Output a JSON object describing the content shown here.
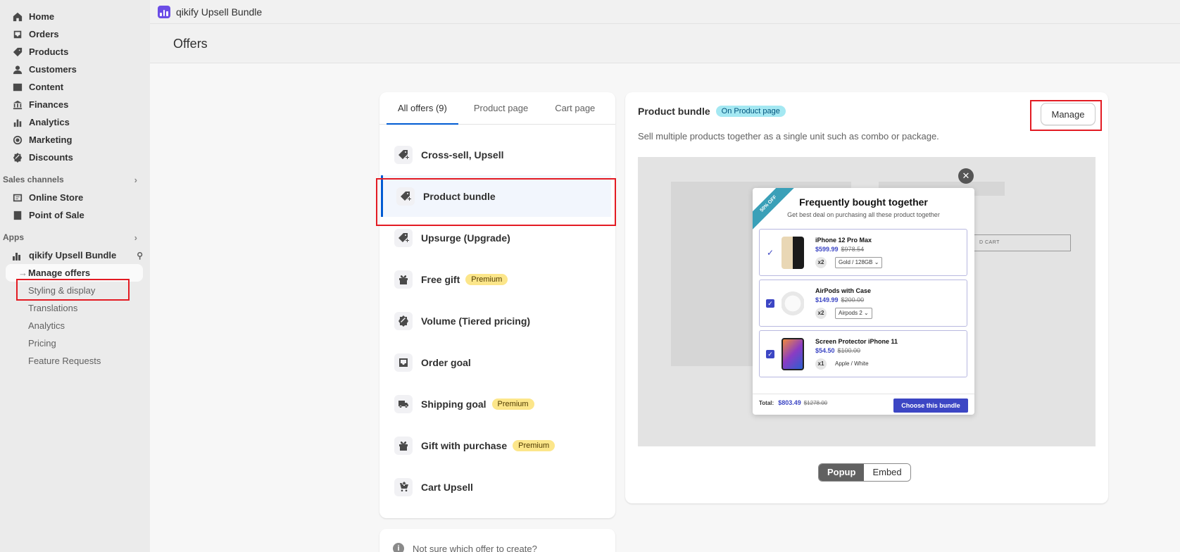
{
  "sidebar": {
    "nav": [
      {
        "label": "Home",
        "icon": "home-icon"
      },
      {
        "label": "Orders",
        "icon": "orders-icon"
      },
      {
        "label": "Products",
        "icon": "tag-icon"
      },
      {
        "label": "Customers",
        "icon": "person-icon"
      },
      {
        "label": "Content",
        "icon": "content-icon"
      },
      {
        "label": "Finances",
        "icon": "bank-icon"
      },
      {
        "label": "Analytics",
        "icon": "bar-chart-icon"
      },
      {
        "label": "Marketing",
        "icon": "target-icon"
      },
      {
        "label": "Discounts",
        "icon": "discount-icon"
      }
    ],
    "sales_channels_heading": "Sales channels",
    "channels": [
      {
        "label": "Online Store",
        "icon": "store-icon"
      },
      {
        "label": "Point of Sale",
        "icon": "pos-icon"
      }
    ],
    "apps_heading": "Apps",
    "app_name": "qikify Upsell Bundle",
    "app_subitems": [
      "Manage offers",
      "Styling & display",
      "Translations",
      "Analytics",
      "Pricing",
      "Feature Requests"
    ]
  },
  "topbar": {
    "title": "qikify Upsell Bundle"
  },
  "page": {
    "title": "Offers"
  },
  "offers": {
    "tabs": [
      "All offers (9)",
      "Product page",
      "Cart page"
    ],
    "items": [
      {
        "label": "Cross-sell, Upsell",
        "premium": ""
      },
      {
        "label": "Product bundle",
        "premium": ""
      },
      {
        "label": "Upsurge (Upgrade)",
        "premium": ""
      },
      {
        "label": "Free gift",
        "premium": "Premium"
      },
      {
        "label": "Volume (Tiered pricing)",
        "premium": ""
      },
      {
        "label": "Order goal",
        "premium": ""
      },
      {
        "label": "Shipping goal",
        "premium": "Premium"
      },
      {
        "label": "Gift with purchase",
        "premium": "Premium"
      },
      {
        "label": "Cart Upsell",
        "premium": ""
      }
    ],
    "help_text": "Not sure which offer to create?"
  },
  "detail": {
    "title": "Product bundle",
    "badge": "On Product page",
    "description": "Sell multiple products together as a single unit such as combo or package.",
    "manage_label": "Manage",
    "preview": {
      "ghost_button": "D CART",
      "ribbon": "50% OFF",
      "title": "Frequently bought together",
      "subtitle": "Get best deal on purchasing all these product together",
      "products": [
        {
          "name": "iPhone 12 Pro Max",
          "price": "$599.99",
          "old_price": "$978.54",
          "qty": "x2",
          "variant": "Gold / 128GB"
        },
        {
          "name": "AirPods with Case",
          "price": "$149.99",
          "old_price": "$200.00",
          "qty": "x2",
          "variant": "Airpods 2"
        },
        {
          "name": "Screen Protector iPhone 11",
          "price": "$54.50",
          "old_price": "$100.00",
          "qty": "x1",
          "variant": "Apple / White"
        }
      ],
      "total_label": "Total:",
      "total_value": "$803.49",
      "total_old": "$1278.00",
      "choose_label": "Choose this bundle"
    },
    "toggle": {
      "popup": "Popup",
      "embed": "Embed"
    }
  }
}
